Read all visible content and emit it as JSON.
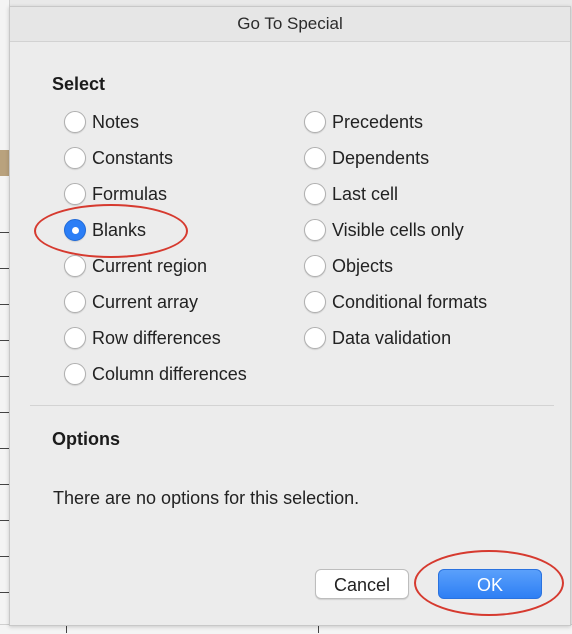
{
  "dialog": {
    "title": "Go To Special",
    "select_label": "Select",
    "left_options": [
      "Notes",
      "Constants",
      "Formulas",
      "Blanks",
      "Current region",
      "Current array",
      "Row differences",
      "Column differences"
    ],
    "right_options": [
      "Precedents",
      "Dependents",
      "Last cell",
      "Visible cells only",
      "Objects",
      "Conditional formats",
      "Data validation"
    ],
    "selected": "Blanks",
    "options_label": "Options",
    "options_text": "There are no options for this selection.",
    "cancel_label": "Cancel",
    "ok_label": "OK"
  },
  "colors": {
    "accent": "#2b7ef6",
    "annotation": "#d63a2f"
  }
}
